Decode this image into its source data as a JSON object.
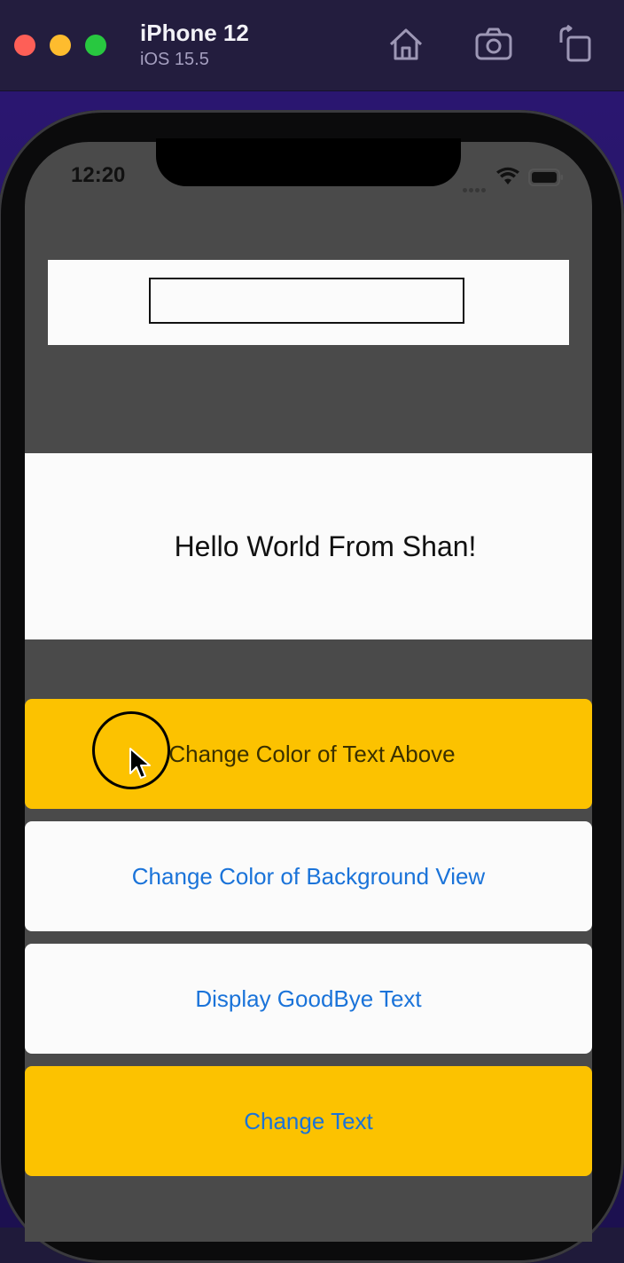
{
  "simulator": {
    "device_name": "iPhone 12",
    "os_version": "iOS 15.5",
    "toolbar_icons": [
      "home-icon",
      "screenshot-icon",
      "rotate-icon"
    ]
  },
  "status_bar": {
    "time": "12:20",
    "icons": [
      "signal-icon",
      "wifi-icon",
      "battery-icon"
    ]
  },
  "app": {
    "text_field": {
      "value": "",
      "placeholder": ""
    },
    "label": "Hello World From Shan!",
    "buttons": [
      {
        "label": "Change Color of Text Above",
        "bg": "#fcc200",
        "color": "#3a3000"
      },
      {
        "label": "Change Color of Background View",
        "bg": "#fbfbfb",
        "color": "#1a73d9"
      },
      {
        "label": "Display GoodBye Text",
        "bg": "#fbfbfb",
        "color": "#1a73d9"
      },
      {
        "label": "Change Text",
        "bg": "#fcc200",
        "color": "#1a73d9"
      }
    ],
    "background_color": "#4a4a4a"
  }
}
